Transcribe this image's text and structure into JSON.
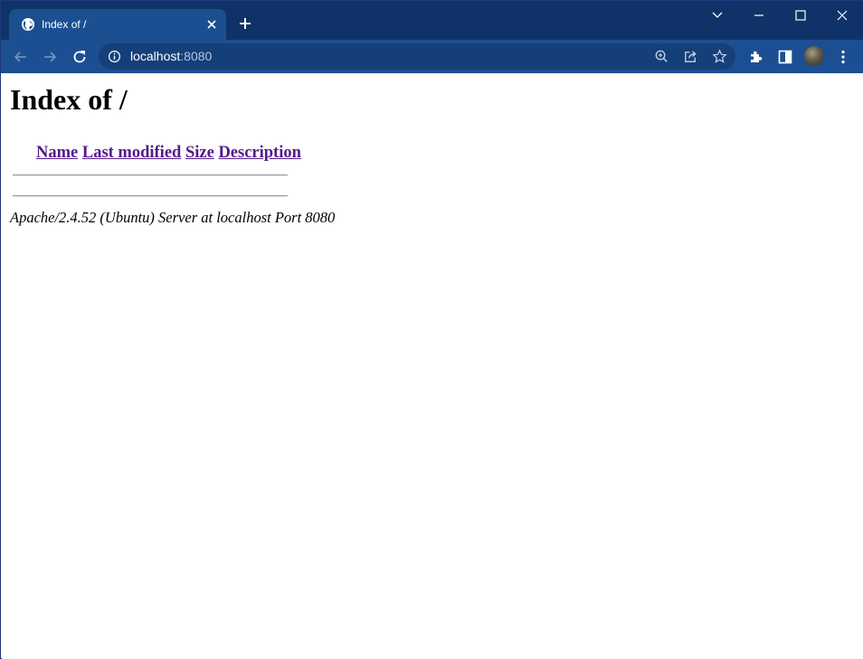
{
  "browser": {
    "tab": {
      "title": "Index of /"
    },
    "address_bar": {
      "host": "localhost",
      "port": ":8080"
    }
  },
  "page": {
    "heading": "Index of /",
    "columns": [
      {
        "label": "Name"
      },
      {
        "label": "Last modified"
      },
      {
        "label": "Size"
      },
      {
        "label": "Description"
      }
    ],
    "footer": "Apache/2.4.52 (Ubuntu) Server at localhost Port 8080"
  },
  "colors": {
    "titlebar": "#0f3368",
    "toolbar": "#1c4f91",
    "visited_link": "#551a8b"
  }
}
